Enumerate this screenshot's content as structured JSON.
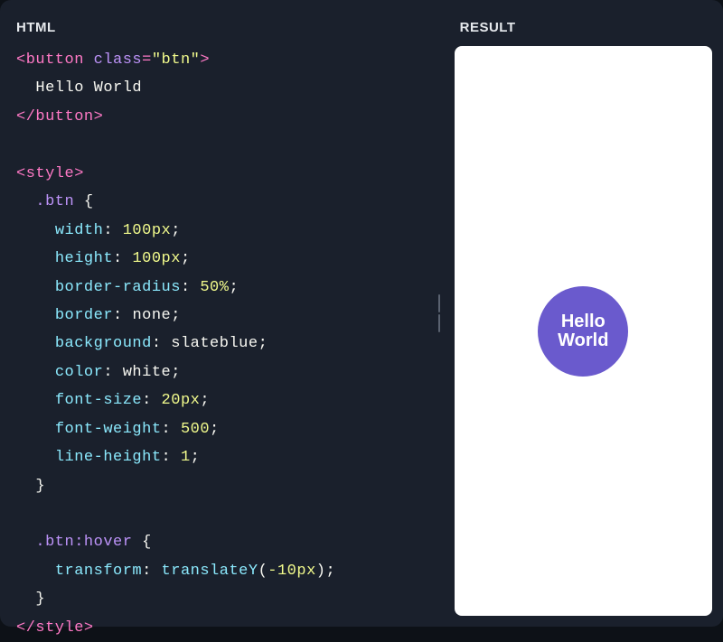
{
  "panels": {
    "left_title": "HTML",
    "right_title": "RESULT"
  },
  "code": {
    "button_open_tag": "button",
    "button_attr_name": "class",
    "button_attr_eq": "=",
    "button_attr_value": "\"btn\"",
    "button_text": "Hello World",
    "button_close_tag": "/button",
    "style_open_tag": "style",
    "style_close_tag": "/style",
    "selector_btn": ".btn",
    "selector_btn_hover": ".btn:hover",
    "brace_open": "{",
    "brace_close": "}",
    "rules": {
      "width": {
        "prop": "width",
        "value": "100px"
      },
      "height": {
        "prop": "height",
        "value": "100px"
      },
      "border_radius": {
        "prop": "border-radius",
        "value": "50%"
      },
      "border": {
        "prop": "border",
        "value": "none"
      },
      "background": {
        "prop": "background",
        "value": "slateblue"
      },
      "color": {
        "prop": "color",
        "value": "white"
      },
      "font_size": {
        "prop": "font-size",
        "value": "20px"
      },
      "font_weight": {
        "prop": "font-weight",
        "value": "500"
      },
      "line_height": {
        "prop": "line-height",
        "value": "1"
      },
      "transform": {
        "prop": "transform",
        "func": "translateY",
        "arg": "-10px"
      }
    }
  },
  "preview": {
    "button_label": "Hello\nWorld"
  },
  "colors": {
    "bg": "#1a202c",
    "preview_bg": "#ffffff",
    "button_bg": "#6a5acd"
  }
}
